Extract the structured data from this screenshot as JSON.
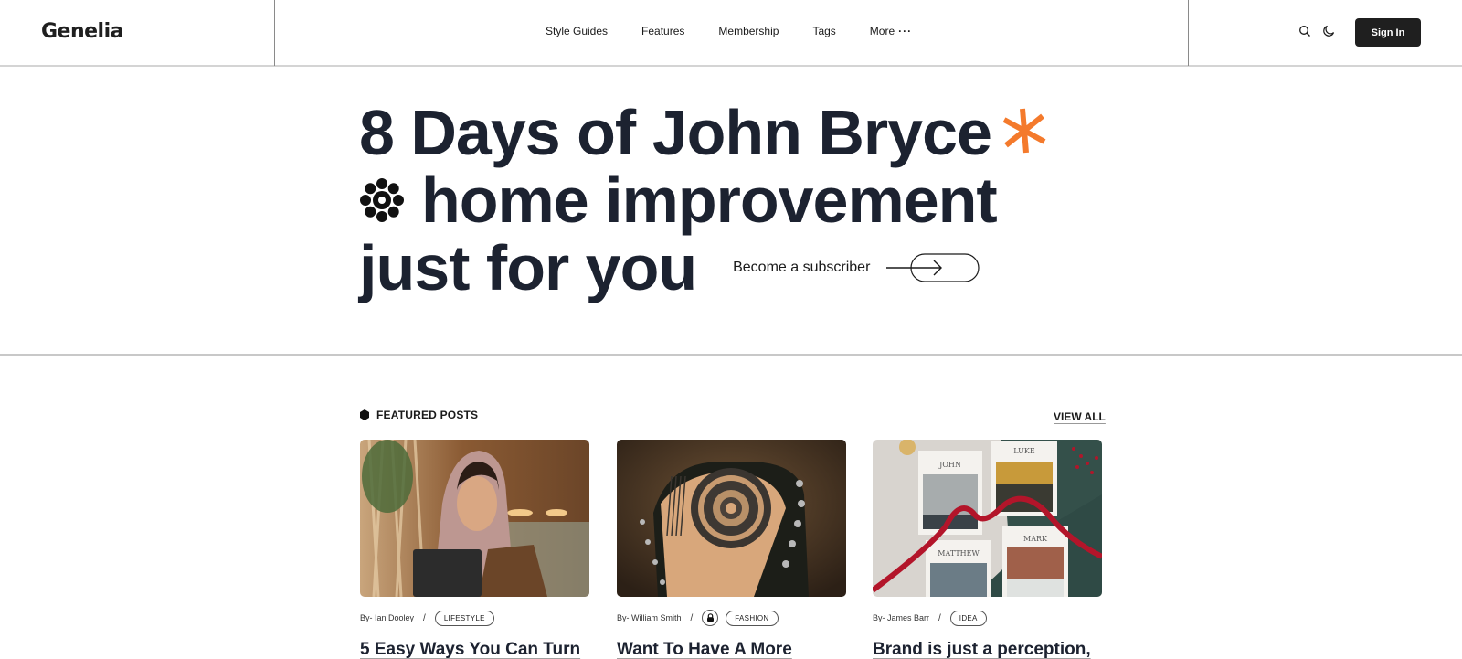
{
  "header": {
    "logo": "Genelia",
    "nav": [
      {
        "label": "Style Guides"
      },
      {
        "label": "Features"
      },
      {
        "label": "Membership"
      },
      {
        "label": "Tags"
      },
      {
        "label": "More"
      }
    ],
    "more_icon": "ellipsis-icon",
    "search_icon": "search-icon",
    "theme_icon": "moon-icon",
    "signin_label": "Sign In"
  },
  "hero": {
    "line1": "8 Days of John Bryce",
    "line2": "home improvement",
    "line3": "just for you",
    "subscribe_label": "Become a subscriber",
    "accent_color": "#f47a2c",
    "text_color": "#1c2230"
  },
  "featured": {
    "heading": "FEATURED POSTS",
    "view_all": "VIEW ALL",
    "posts": [
      {
        "author": "By- Ian Dooley",
        "tag": "LIFESTYLE",
        "locked": false,
        "title": "5 Easy Ways You Can Turn",
        "image": "woman-in-hijab-holding-laptop"
      },
      {
        "author": "By- William Smith",
        "tag": "FASHION",
        "locked": true,
        "title": "Want To Have A More",
        "image": "back-mandala-tattoo"
      },
      {
        "author": "By- James Barr",
        "tag": "IDEA",
        "locked": false,
        "title": "Brand is just a perception,",
        "image": "gospel-books-john-luke-matthew-mark"
      }
    ],
    "book_labels": [
      "JOHN",
      "LUKE",
      "MATTHEW",
      "MARK"
    ]
  }
}
